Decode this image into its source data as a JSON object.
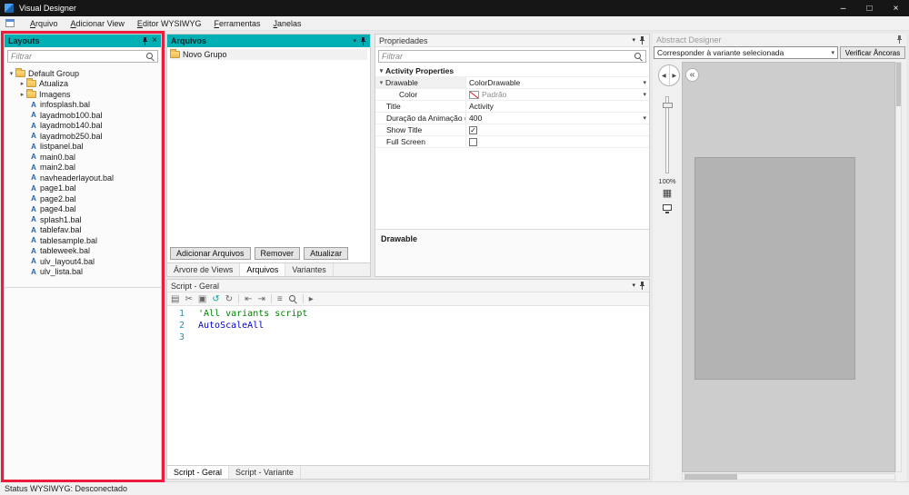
{
  "window": {
    "title": "Visual Designer",
    "controls": {
      "minimize": "–",
      "maximize": "□",
      "close": "×"
    }
  },
  "menu": {
    "items": [
      "Arquivo",
      "Adicionar View",
      "Editor WYSIWYG",
      "Ferramentas",
      "Janelas"
    ]
  },
  "icons": {
    "expanded": "▾",
    "collapsed": "▸",
    "dropdown": "▾",
    "close": "×",
    "layout_file": "A",
    "back": "◀",
    "forward": "▶",
    "collapse_double": "«",
    "grid": "▦"
  },
  "layouts_panel": {
    "title": "Layouts",
    "filter_placeholder": "Filtrar",
    "tree": {
      "root": "Default Group",
      "folders": [
        "Atualiza",
        "Imagens"
      ],
      "files": [
        "infosplash.bal",
        "layadmob100.bal",
        "layadmob140.bal",
        "layadmob250.bal",
        "listpanel.bal",
        "main0.bal",
        "main2.bal",
        "navheaderlayout.bal",
        "page1.bal",
        "page2.bal",
        "page4.bal",
        "splash1.bal",
        "tablefav.bal",
        "tablesample.bal",
        "tableweek.bal",
        "ulv_layout4.bal",
        "ulv_lista.bal"
      ]
    }
  },
  "files_panel": {
    "title": "Arquivos",
    "group_label": "Novo Grupo",
    "buttons": {
      "add": "Adicionar Arquivos",
      "remove": "Remover",
      "refresh": "Atualizar"
    },
    "tabs": [
      "Árvore de Views",
      "Arquivos",
      "Variantes"
    ],
    "active_tab": "Arquivos"
  },
  "properties_panel": {
    "title": "Propriedades",
    "filter_placeholder": "Filtrar",
    "category": "Activity Properties",
    "rows": {
      "drawable": {
        "label": "Drawable",
        "value": "ColorDrawable"
      },
      "color": {
        "label": "Color",
        "value": "Padrão"
      },
      "title": {
        "label": "Title",
        "value": "Activity"
      },
      "anim": {
        "label": "Duração da Animação (ms)",
        "value": "400"
      },
      "show_title": {
        "label": "Show Title",
        "checked": true
      },
      "full_screen": {
        "label": "Full Screen",
        "checked": false
      }
    },
    "description_title": "Drawable"
  },
  "script_panel": {
    "title": "Script - Geral",
    "toolbar": {
      "paste": "▤",
      "cut": "✂",
      "copy": "▣",
      "undo": "↺",
      "redo": "↻",
      "outdent": "⇤",
      "indent": "⇥",
      "comment": "≡",
      "run": "▸"
    },
    "lines": [
      {
        "num": "1",
        "code": "'All variants script",
        "type": "comment"
      },
      {
        "num": "2",
        "code": "AutoScaleAll",
        "type": "keyword"
      },
      {
        "num": "3",
        "code": "",
        "type": "plain"
      }
    ],
    "tabs": [
      "Script - Geral",
      "Script - Variante"
    ],
    "active_tab": "Script - Geral"
  },
  "abstract_panel": {
    "title": "Abstract Designer",
    "variant_selector": "Corresponder à variante selecionada",
    "anchor_button": "Verificar Âncoras",
    "zoom": "100%"
  },
  "status_bar": {
    "text": "Status WYSIWYG: Desconectado"
  },
  "colors": {
    "accent_teal": "#00afb4",
    "highlight_red": "#ec1c3c",
    "comment_green": "#008000",
    "keyword_blue": "#0000cc",
    "titlebar": "#161616"
  }
}
